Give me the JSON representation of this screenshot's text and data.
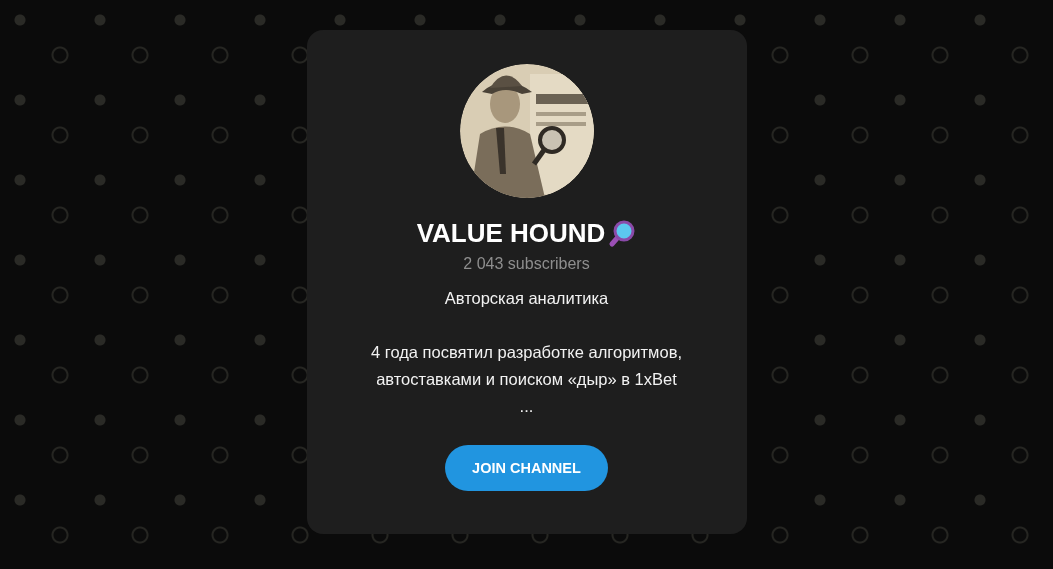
{
  "channel": {
    "title": "VALUE HOUND",
    "subscribers": "2 043 subscribers",
    "description": "Авторская аналитика\n\n4 года посвятил разработке алгоритмов,\nавтоставками и поиском «дыр» в 1xBet\n..."
  },
  "buttons": [
    {
      "label": "JOIN CHANNEL"
    }
  ]
}
